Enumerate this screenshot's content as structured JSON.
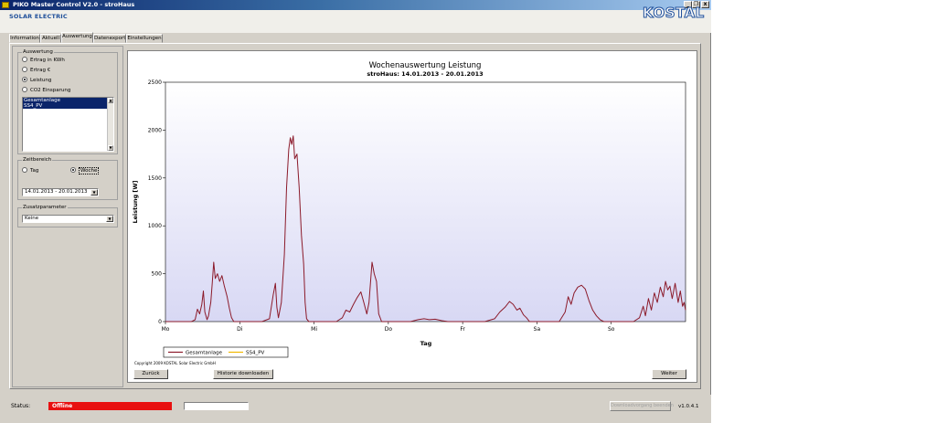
{
  "window": {
    "title": "PIKO Master Control V2.0 - stroHaus",
    "min_label": "_",
    "restore_label": "❐",
    "close_label": "x"
  },
  "header": {
    "app_name": "SOLAR ELECTRIC",
    "logo_text": "KOSTAL"
  },
  "tabs": [
    {
      "label": "Information"
    },
    {
      "label": "Aktuell"
    },
    {
      "label": "Auswertung",
      "active": true
    },
    {
      "label": "Datenexport"
    },
    {
      "label": "Einstellungen"
    }
  ],
  "left_panel": {
    "auswertung": {
      "legend": "Auswertung",
      "options": [
        {
          "label": "Ertrag in KWh",
          "selected": false
        },
        {
          "label": "Ertrag €",
          "selected": false
        },
        {
          "label": "Leistung",
          "selected": true
        },
        {
          "label": "CO2 Einsparung",
          "selected": false
        }
      ],
      "list_items": [
        "Gesamtanlage",
        "SS4_PV"
      ],
      "scroll_up": "▲",
      "scroll_down": "▼"
    },
    "zeitbereich": {
      "legend": "Zeitbereich",
      "option_tag": "Tag",
      "option_woche": "Woche",
      "selected": "Woche",
      "date_range": "14.01.2013 - 20.01.2013",
      "dropdown_arrow": "▼"
    },
    "zusatzparameter": {
      "legend": "Zusatzparameter",
      "value": "Keine",
      "dropdown_arrow": "▼"
    }
  },
  "buttons": {
    "back": "Zurück",
    "download_history": "Historie downloaden",
    "next": "Weiter"
  },
  "status": {
    "label": "Status:",
    "value": "Offline",
    "colors": {
      "offline": "#e81010"
    },
    "download_button": "Downloadvorgang beenden",
    "version": "v1.0.4.1"
  },
  "copyright": "Copyright 2009 KOSTAL Solar Electric GmbH",
  "chart_data": {
    "type": "line",
    "title": "Wochenauswertung Leistung",
    "subtitle": "stroHaus: 14.01.2013 - 20.01.2013",
    "xlabel": "Tag",
    "ylabel": "Leistung [W]",
    "ylim": [
      0,
      2500
    ],
    "yticks": [
      0,
      500,
      1000,
      1500,
      2000,
      2500
    ],
    "xlim": [
      0,
      7
    ],
    "xtick_labels": [
      "Mo",
      "Di",
      "Mi",
      "Do",
      "Fr",
      "Sa",
      "So"
    ],
    "grid": false,
    "legend_position": "bottom-left",
    "colors": {
      "Gesamtanlage": "#8b1a2a",
      "SS4_PV": "#f0b800",
      "plot_bg_top": "#ffffff",
      "plot_bg_bottom": "#d8d8f4"
    },
    "series": [
      {
        "name": "Gesamtanlage",
        "points": [
          [
            0.0,
            0
          ],
          [
            0.35,
            0
          ],
          [
            0.4,
            20
          ],
          [
            0.43,
            130
          ],
          [
            0.46,
            80
          ],
          [
            0.49,
            180
          ],
          [
            0.51,
            320
          ],
          [
            0.53,
            100
          ],
          [
            0.56,
            20
          ],
          [
            0.58,
            60
          ],
          [
            0.61,
            200
          ],
          [
            0.63,
            400
          ],
          [
            0.65,
            620
          ],
          [
            0.67,
            450
          ],
          [
            0.7,
            500
          ],
          [
            0.73,
            420
          ],
          [
            0.76,
            480
          ],
          [
            0.79,
            380
          ],
          [
            0.83,
            260
          ],
          [
            0.86,
            140
          ],
          [
            0.89,
            40
          ],
          [
            0.92,
            0
          ],
          [
            1.3,
            0
          ],
          [
            1.4,
            30
          ],
          [
            1.45,
            280
          ],
          [
            1.48,
            400
          ],
          [
            1.5,
            150
          ],
          [
            1.52,
            40
          ],
          [
            1.56,
            200
          ],
          [
            1.6,
            700
          ],
          [
            1.63,
            1400
          ],
          [
            1.66,
            1800
          ],
          [
            1.68,
            1920
          ],
          [
            1.7,
            1850
          ],
          [
            1.72,
            1940
          ],
          [
            1.74,
            1700
          ],
          [
            1.77,
            1750
          ],
          [
            1.8,
            1400
          ],
          [
            1.83,
            900
          ],
          [
            1.86,
            600
          ],
          [
            1.88,
            200
          ],
          [
            1.9,
            30
          ],
          [
            1.93,
            0
          ],
          [
            2.3,
            0
          ],
          [
            2.38,
            40
          ],
          [
            2.43,
            120
          ],
          [
            2.48,
            100
          ],
          [
            2.53,
            180
          ],
          [
            2.58,
            250
          ],
          [
            2.63,
            310
          ],
          [
            2.67,
            200
          ],
          [
            2.71,
            80
          ],
          [
            2.74,
            200
          ],
          [
            2.78,
            620
          ],
          [
            2.81,
            500
          ],
          [
            2.84,
            420
          ],
          [
            2.87,
            80
          ],
          [
            2.91,
            0
          ],
          [
            3.3,
            0
          ],
          [
            3.4,
            20
          ],
          [
            3.48,
            30
          ],
          [
            3.55,
            20
          ],
          [
            3.63,
            25
          ],
          [
            3.72,
            10
          ],
          [
            3.8,
            0
          ],
          [
            4.3,
            0
          ],
          [
            4.43,
            30
          ],
          [
            4.5,
            100
          ],
          [
            4.57,
            150
          ],
          [
            4.63,
            210
          ],
          [
            4.68,
            180
          ],
          [
            4.73,
            120
          ],
          [
            4.77,
            140
          ],
          [
            4.82,
            70
          ],
          [
            4.86,
            40
          ],
          [
            4.9,
            0
          ],
          [
            5.3,
            0
          ],
          [
            5.38,
            100
          ],
          [
            5.42,
            260
          ],
          [
            5.46,
            180
          ],
          [
            5.5,
            300
          ],
          [
            5.55,
            360
          ],
          [
            5.6,
            380
          ],
          [
            5.65,
            340
          ],
          [
            5.7,
            220
          ],
          [
            5.75,
            120
          ],
          [
            5.8,
            60
          ],
          [
            5.85,
            20
          ],
          [
            5.9,
            0
          ],
          [
            6.3,
            0
          ],
          [
            6.38,
            40
          ],
          [
            6.43,
            160
          ],
          [
            6.46,
            60
          ],
          [
            6.5,
            240
          ],
          [
            6.54,
            120
          ],
          [
            6.58,
            300
          ],
          [
            6.62,
            200
          ],
          [
            6.66,
            360
          ],
          [
            6.7,
            260
          ],
          [
            6.73,
            420
          ],
          [
            6.76,
            330
          ],
          [
            6.79,
            370
          ],
          [
            6.82,
            240
          ],
          [
            6.86,
            400
          ],
          [
            6.9,
            200
          ],
          [
            6.93,
            320
          ],
          [
            6.96,
            160
          ],
          [
            6.98,
            200
          ],
          [
            7.0,
            120
          ]
        ]
      },
      {
        "name": "SS4_PV",
        "points": []
      }
    ]
  }
}
